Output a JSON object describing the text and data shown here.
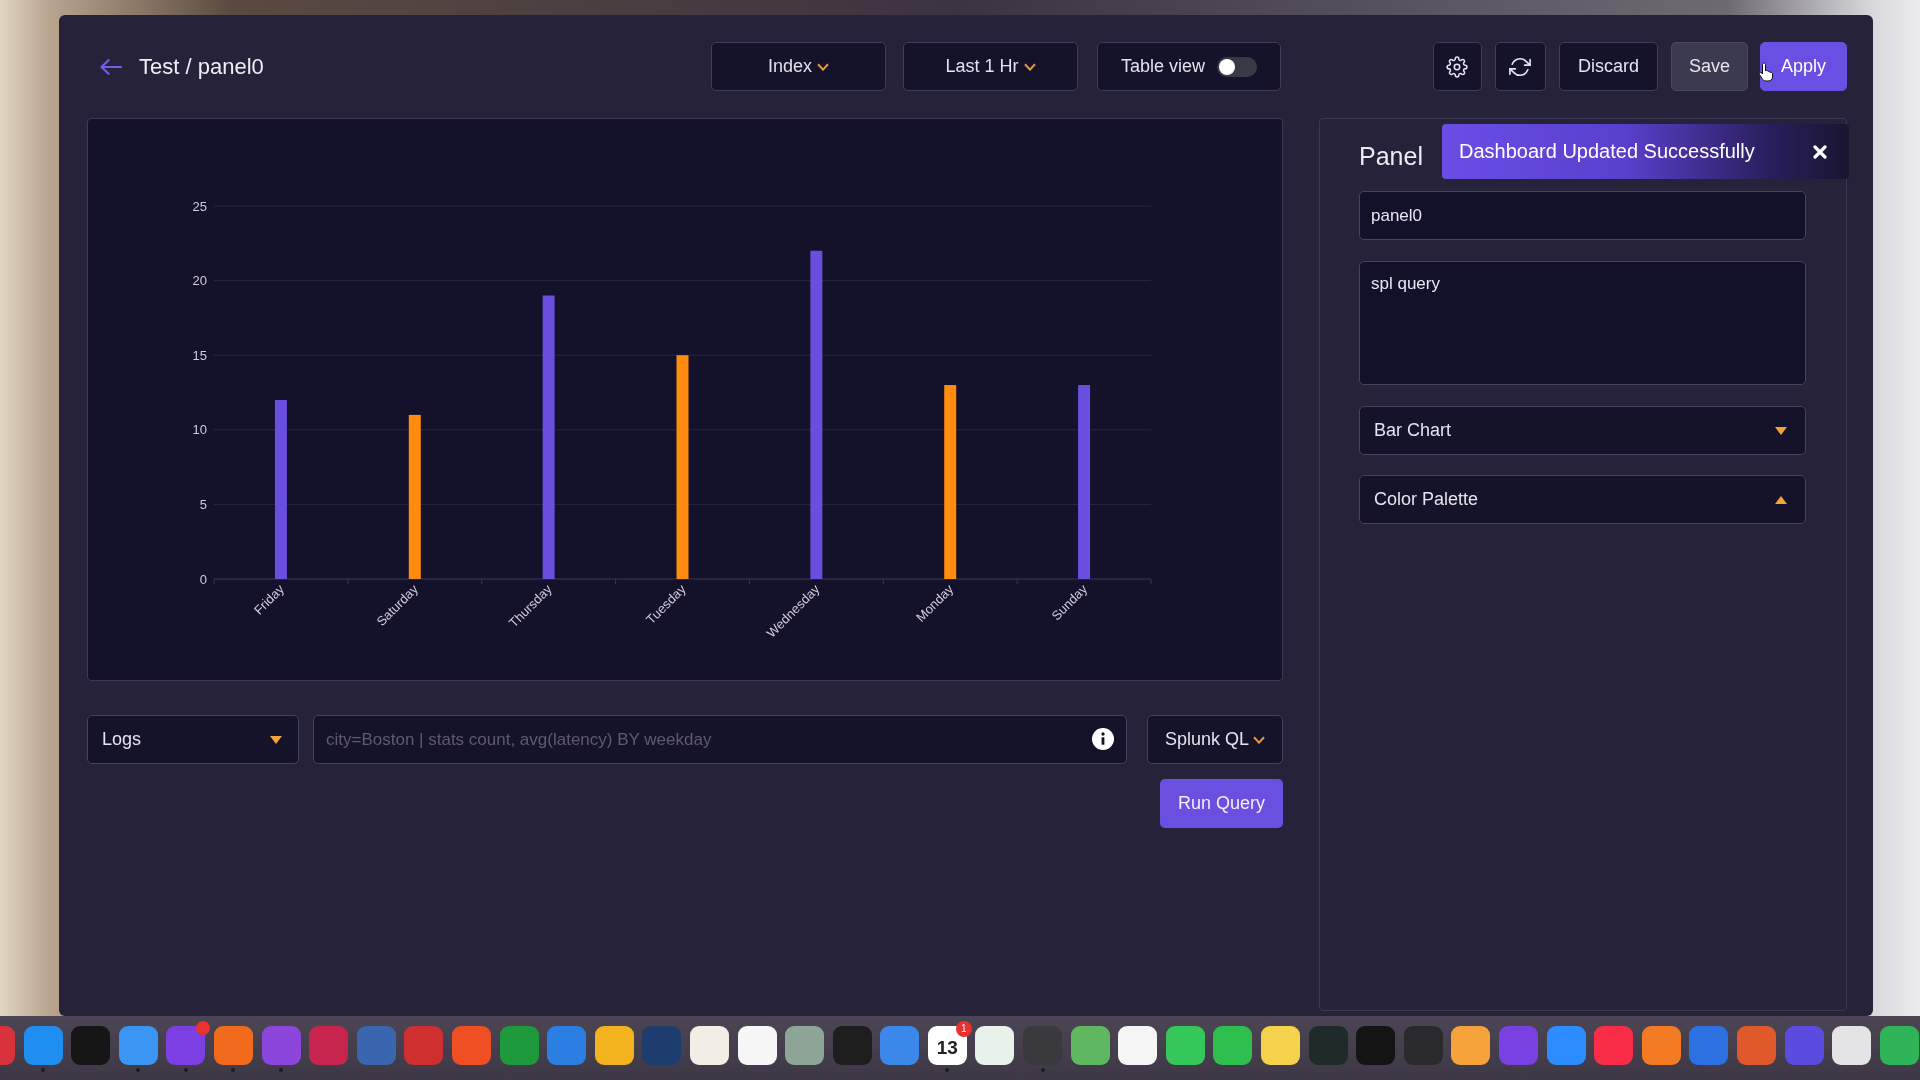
{
  "header": {
    "title": "Test / panel0",
    "dropdowns": [
      {
        "label": "Index"
      },
      {
        "label": "Last 1 Hr"
      }
    ],
    "table_view": {
      "label": "Table view",
      "on": false
    },
    "actions": [
      {
        "kind": "settings"
      },
      {
        "kind": "refresh"
      },
      {
        "kind": "outline",
        "label": "Discard"
      },
      {
        "kind": "muted",
        "label": "Save"
      },
      {
        "kind": "primary",
        "label": "Apply"
      }
    ]
  },
  "chart_panel": {
    "chart_data": {
      "type": "bar",
      "categories": [
        "Friday",
        "Saturday",
        "Thursday",
        "Tuesday",
        "Wednesday",
        "Monday",
        "Sunday"
      ],
      "series": [
        {
          "colors": [
            "#6a4fde",
            "#ff8c0f",
            "#6a4fde",
            "#ff8c0f",
            "#6a4fde",
            "#ff8c0f",
            "#6a4fde"
          ],
          "values": [
            12,
            11,
            19,
            15,
            22,
            13,
            13
          ]
        }
      ],
      "ylim": [
        0,
        25
      ],
      "yticks": [
        0,
        5,
        10,
        15,
        20,
        25
      ],
      "grid": true
    }
  },
  "query_bar": {
    "source": {
      "value": "Logs",
      "expanded": false
    },
    "query_field": {
      "placeholder": "city=Boston | stats count, avg(latency) BY weekday"
    },
    "language": {
      "label": "Splunk QL"
    },
    "run_button": "Run Query"
  },
  "panel_settings": {
    "title": "Panel",
    "name_field": {
      "value": "panel0"
    },
    "query_field": {
      "value": "spl query"
    },
    "selects": [
      {
        "value": "Bar Chart",
        "expanded": false
      },
      {
        "value": "Color Palette",
        "expanded": true
      }
    ]
  },
  "toast": {
    "message": "Dashboard Updated Successfully"
  },
  "dock": {
    "apps": [
      {
        "kind": "cut",
        "color": "#d8333b",
        "running": false
      },
      {
        "kind": "tile",
        "color": "#1f8ef1",
        "running": true
      },
      {
        "kind": "tile",
        "color": "#161616",
        "running": false
      },
      {
        "kind": "tile",
        "color": "#3b95f2",
        "running": true
      },
      {
        "kind": "tile",
        "color": "#7b3fe4",
        "running": true,
        "notified": true
      },
      {
        "kind": "tile",
        "color": "#f26b1d",
        "running": true
      },
      {
        "kind": "tile",
        "color": "#8c46dc",
        "running": true
      },
      {
        "kind": "tile",
        "color": "#c7254e",
        "running": false
      },
      {
        "kind": "tile",
        "color": "#3a66b0",
        "running": false
      },
      {
        "kind": "tile",
        "color": "#cf2f2f",
        "running": false
      },
      {
        "kind": "tile",
        "color": "#f04e23",
        "running": false
      },
      {
        "kind": "tile",
        "color": "#1e9a3c",
        "running": false
      },
      {
        "kind": "tile",
        "color": "#2b7fe3",
        "running": false
      },
      {
        "kind": "tile",
        "color": "#f2b31f",
        "running": false
      },
      {
        "kind": "tile",
        "color": "#1d3d6e",
        "running": false
      },
      {
        "kind": "tile",
        "color": "#f2ede5",
        "running": false
      },
      {
        "kind": "tile",
        "color": "#f7f7f7",
        "running": false
      },
      {
        "kind": "tile",
        "color": "#8da596",
        "running": false
      },
      {
        "kind": "tile",
        "color": "#1e1e1e",
        "running": false
      },
      {
        "kind": "tile",
        "color": "#3b88ea",
        "running": false
      },
      {
        "kind": "calendar",
        "color": "#ffffff",
        "label": "13",
        "badge": "1",
        "running": true
      },
      {
        "kind": "tile",
        "color": "#e8f2ea",
        "running": false
      },
      {
        "kind": "tile",
        "color": "#3a3a3e",
        "running": true
      },
      {
        "kind": "tile",
        "color": "#5fb760",
        "running": false
      },
      {
        "kind": "tile",
        "color": "#f5f5f5",
        "running": false
      },
      {
        "kind": "tile",
        "color": "#35c759",
        "running": false
      },
      {
        "kind": "tile",
        "color": "#2fbf4f",
        "running": false
      },
      {
        "kind": "tile",
        "color": "#f4d24b",
        "running": false
      },
      {
        "kind": "tile",
        "color": "#1f2b2b",
        "running": false
      },
      {
        "kind": "tile",
        "color": "#141414",
        "running": false
      },
      {
        "kind": "tile",
        "color": "#2a2a2e",
        "running": false
      },
      {
        "kind": "tile",
        "color": "#f5a33a",
        "running": false
      },
      {
        "kind": "tile",
        "color": "#7a41e2",
        "running": false
      },
      {
        "kind": "tile",
        "color": "#2d8cff",
        "running": false
      },
      {
        "kind": "tile",
        "color": "#fa2d48",
        "running": false
      },
      {
        "kind": "tile",
        "color": "#f27a22",
        "running": false
      },
      {
        "kind": "tile",
        "color": "#2c70e2",
        "running": false
      },
      {
        "kind": "tile",
        "color": "#e0592b",
        "running": false
      },
      {
        "kind": "tile",
        "color": "#5b4be0",
        "running": false
      },
      {
        "kind": "tile",
        "color": "#e4e4e6",
        "running": false
      },
      {
        "kind": "tile",
        "color": "#2fb557",
        "running": false
      }
    ]
  }
}
